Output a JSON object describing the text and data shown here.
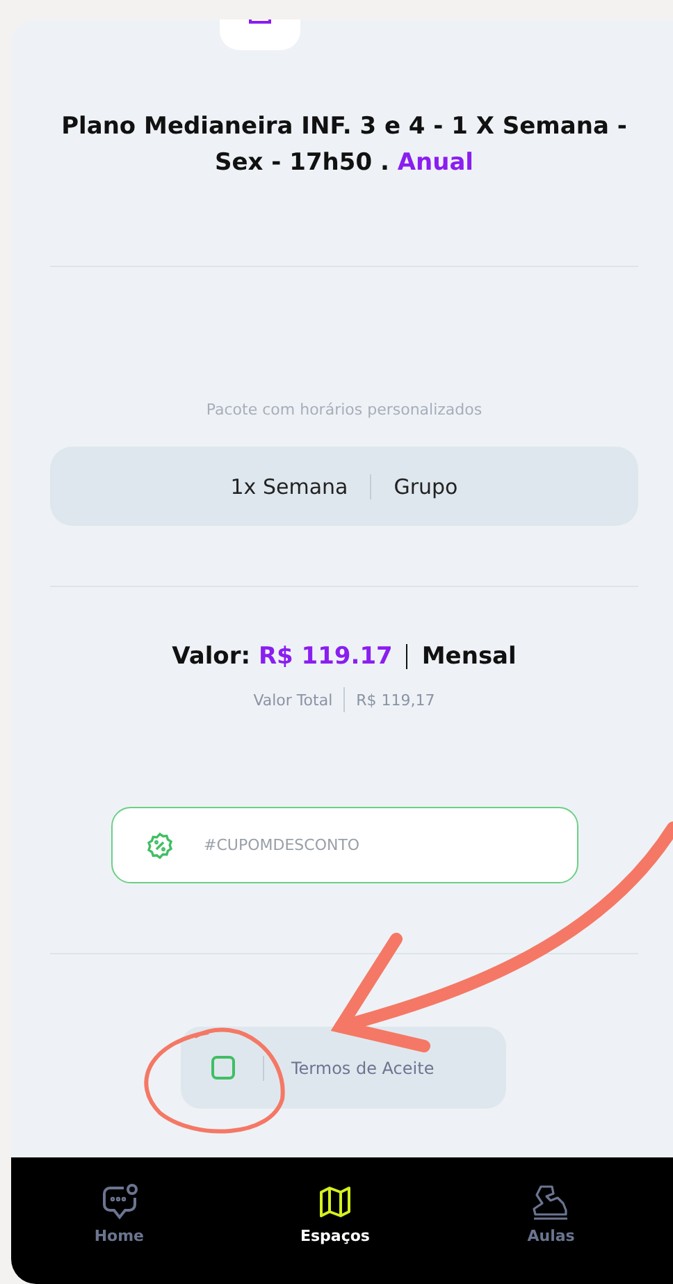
{
  "plan": {
    "title": "Plano Medianeira INF. 3 e 4 -  1 X Semana - Sex - 17h50 .",
    "period": "Anual"
  },
  "package": {
    "subtitle": "Pacote com horários personalizados",
    "frequency": "1x Semana",
    "type": "Grupo"
  },
  "price": {
    "label": "Valor:",
    "amount": "R$ 119.17",
    "period": "Mensal",
    "total_label": "Valor Total",
    "total_value": "R$ 119,17"
  },
  "coupon": {
    "placeholder": "#CUPOMDESCONTO"
  },
  "terms": {
    "checked": false,
    "label": "Termos de Aceite"
  },
  "nav": [
    {
      "label": "Home",
      "kind": "chat",
      "selected": false
    },
    {
      "label": "Espaços",
      "kind": "map",
      "selected": true
    },
    {
      "label": "Aulas",
      "kind": "shoe",
      "selected": false
    }
  ]
}
